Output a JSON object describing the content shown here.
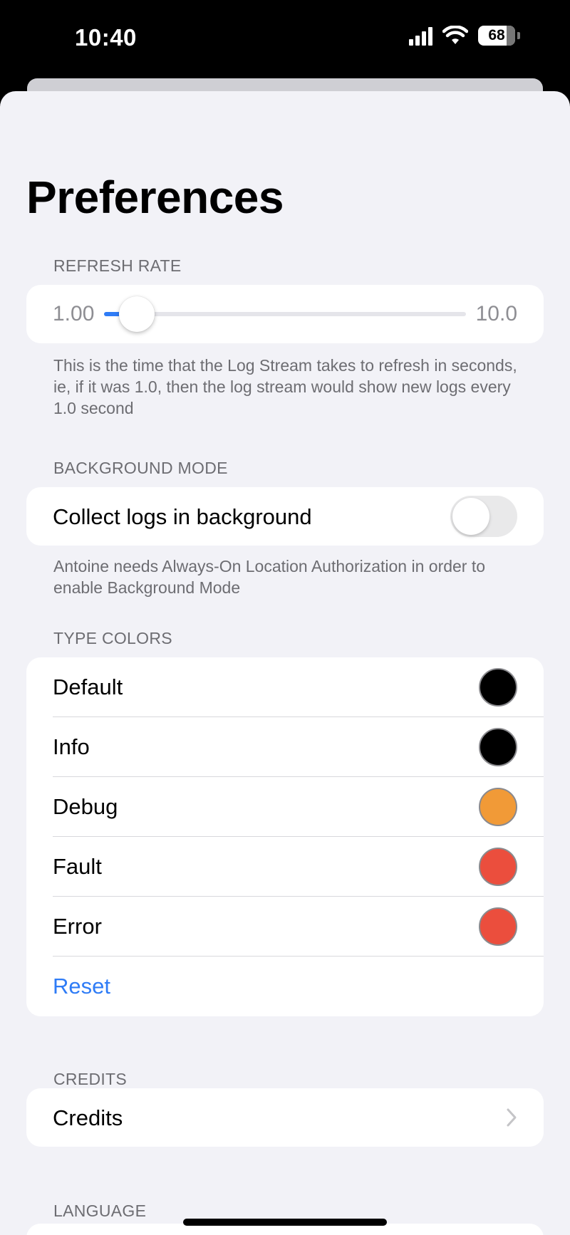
{
  "status_bar": {
    "time": "10:40",
    "battery": "68"
  },
  "title": "Preferences",
  "refresh_rate": {
    "header": "REFRESH RATE",
    "min_label": "1.00",
    "max_label": "10.0",
    "value": 1.0,
    "min": 1.0,
    "max": 10.0,
    "footer": "This is the time that the Log Stream takes to refresh in seconds, ie, if it was 1.0, then the log stream would show new logs every 1.0 second"
  },
  "background_mode": {
    "header": "BACKGROUND MODE",
    "toggle_label": "Collect logs in background",
    "enabled": false,
    "footer": "Antoine needs Always-On Location Authorization in order to enable Background Mode"
  },
  "type_colors": {
    "header": "TYPE COLORS",
    "items": [
      {
        "label": "Default",
        "color": "#000000"
      },
      {
        "label": "Info",
        "color": "#000000"
      },
      {
        "label": "Debug",
        "color": "#f19a37"
      },
      {
        "label": "Fault",
        "color": "#eb4e3d"
      },
      {
        "label": "Error",
        "color": "#eb4e3d"
      }
    ],
    "reset_label": "Reset"
  },
  "credits": {
    "header": "CREDITS",
    "row_label": "Credits"
  },
  "language": {
    "header": "LANGUAGE"
  }
}
